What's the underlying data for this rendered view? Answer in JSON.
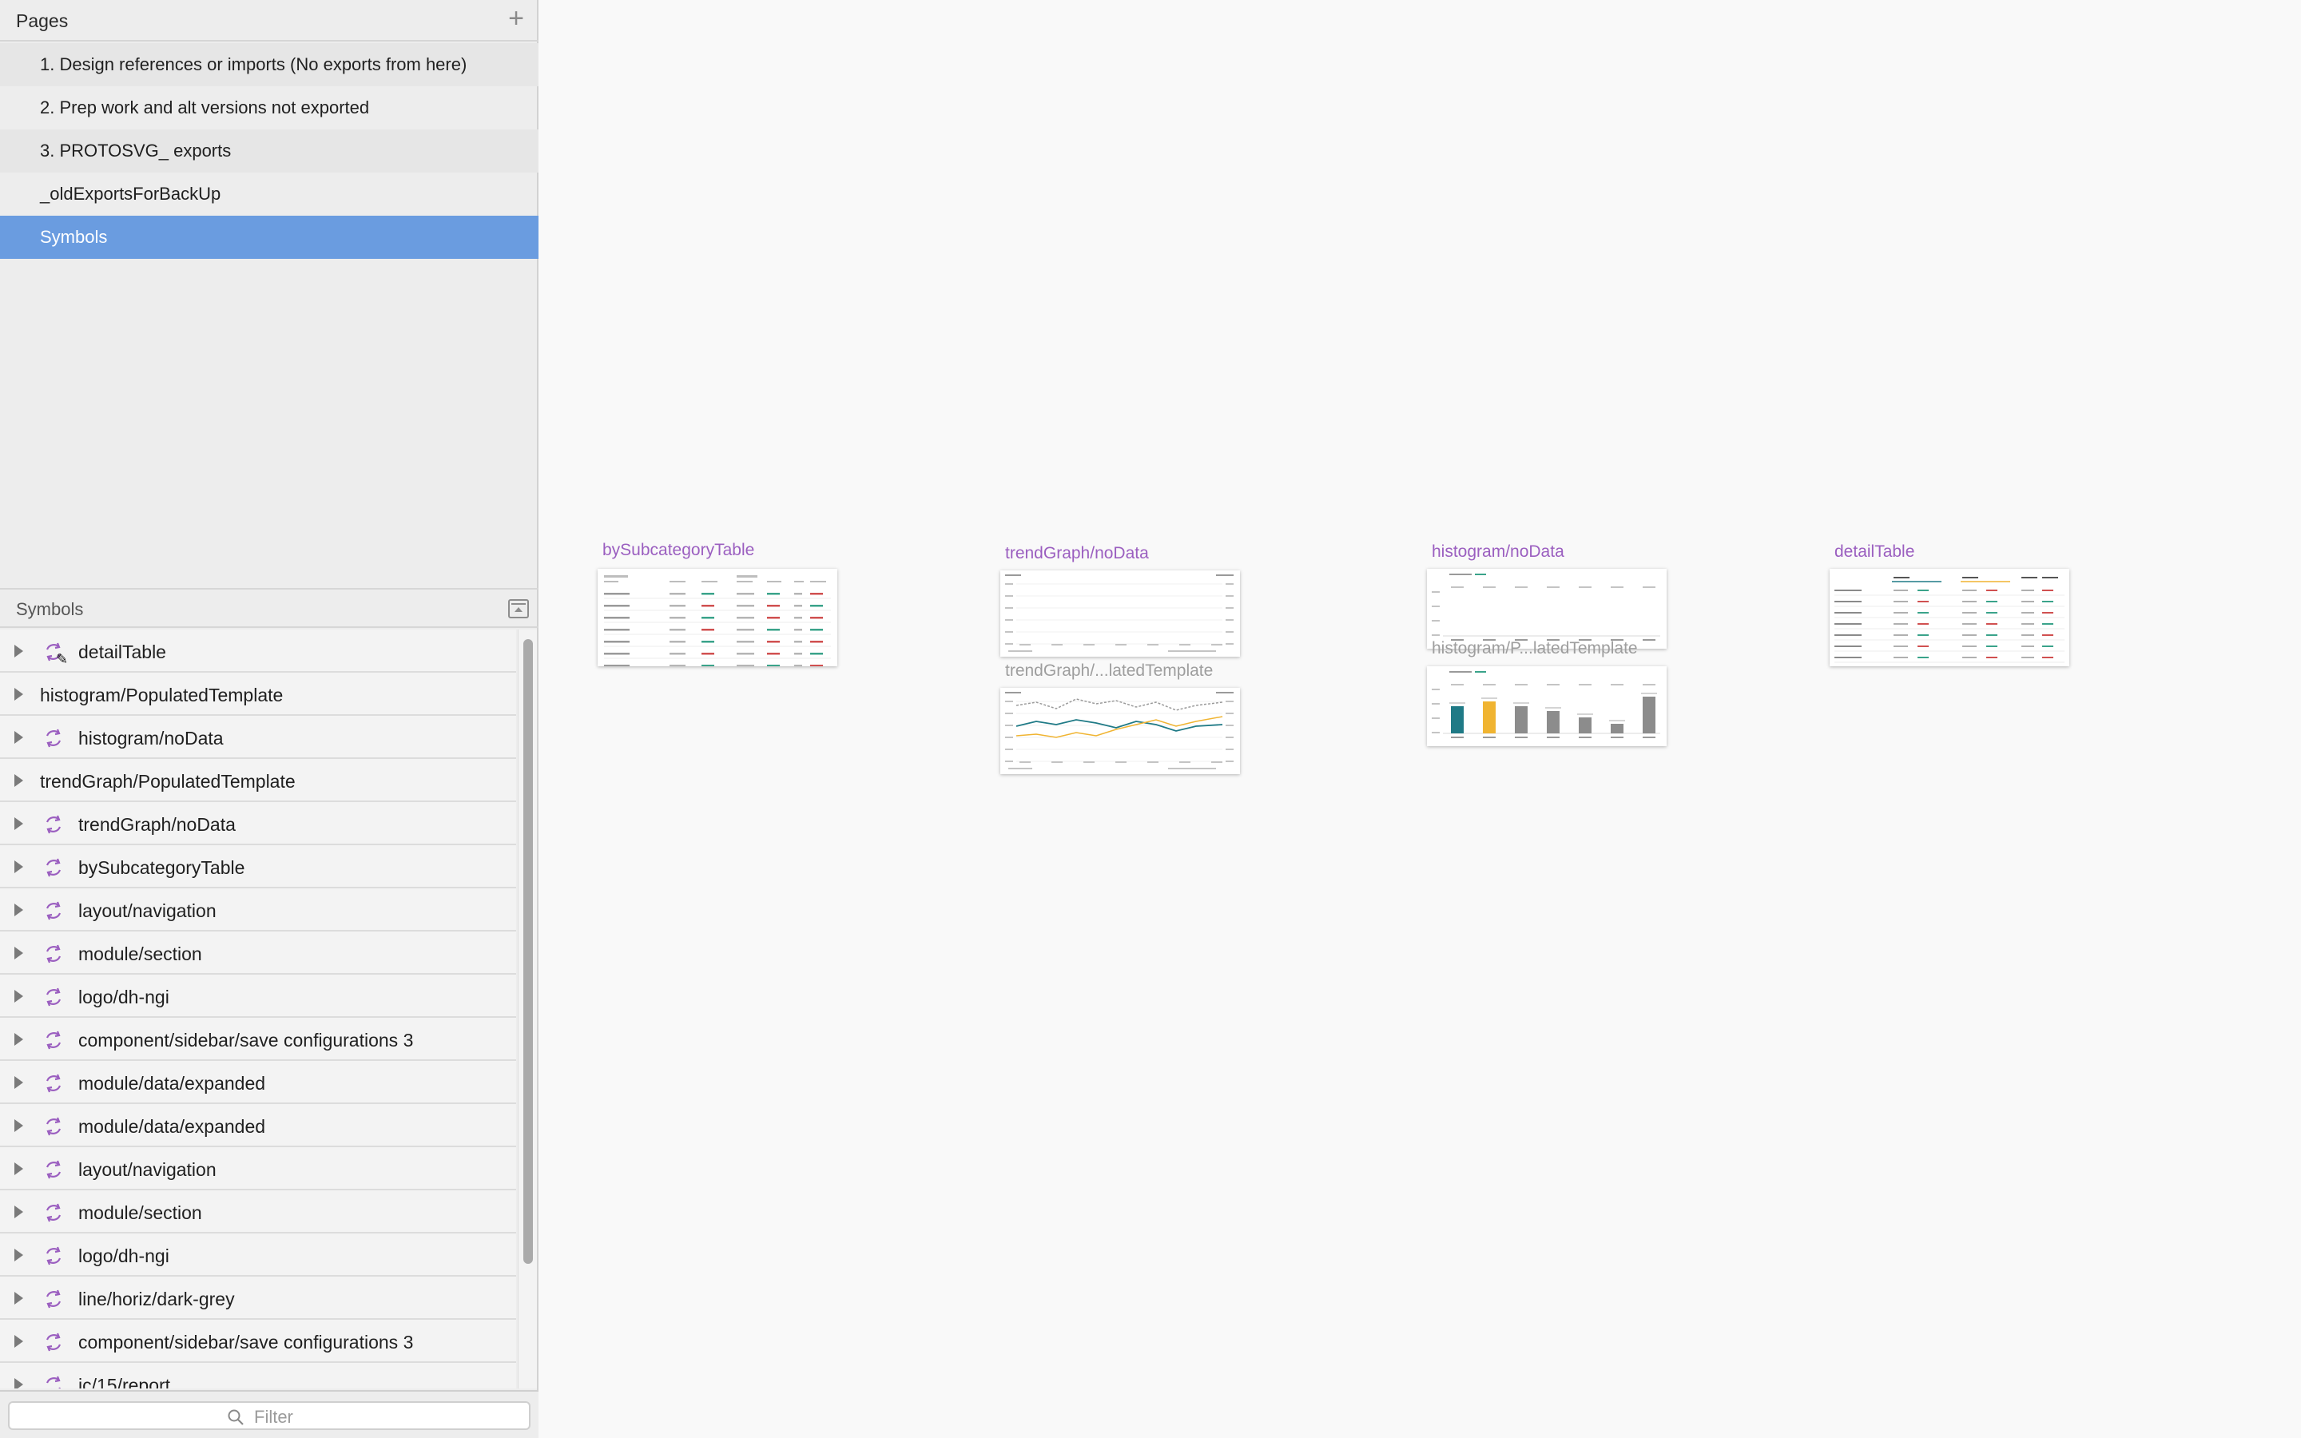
{
  "pages": {
    "title": "Pages",
    "add_icon": "plus-icon",
    "items": [
      {
        "label": "1. Design references or imports (No exports from here)"
      },
      {
        "label": "2. Prep work and alt versions not exported"
      },
      {
        "label": "3. PROTOSVG_ exports"
      },
      {
        "label": "_oldExportsForBackUp"
      },
      {
        "label": "Symbols"
      }
    ],
    "selected": "Symbols"
  },
  "layers": {
    "title": "Symbols",
    "items": [
      {
        "label": "detailTable",
        "symbol": true,
        "editing": true
      },
      {
        "label": "histogram/PopulatedTemplate",
        "symbol": false
      },
      {
        "label": "histogram/noData",
        "symbol": true
      },
      {
        "label": "trendGraph/PopulatedTemplate",
        "symbol": false
      },
      {
        "label": "trendGraph/noData",
        "symbol": true
      },
      {
        "label": "bySubcategoryTable",
        "symbol": true
      },
      {
        "label": "layout/navigation",
        "symbol": true
      },
      {
        "label": "module/section",
        "symbol": true
      },
      {
        "label": "logo/dh-ngi",
        "symbol": true
      },
      {
        "label": "component/sidebar/save configurations 3",
        "symbol": true
      },
      {
        "label": "module/data/expanded",
        "symbol": true
      },
      {
        "label": "module/data/expanded",
        "symbol": true
      },
      {
        "label": "layout/navigation",
        "symbol": true
      },
      {
        "label": "module/section",
        "symbol": true
      },
      {
        "label": "logo/dh-ngi",
        "symbol": true
      },
      {
        "label": "line/horiz/dark-grey",
        "symbol": true
      },
      {
        "label": "component/sidebar/save configurations 3",
        "symbol": true
      },
      {
        "label": "ic/15/report",
        "symbol": true
      }
    ]
  },
  "filter": {
    "placeholder": "Filter"
  },
  "canvas": {
    "artboards": [
      {
        "label": "bySubcategoryTable"
      },
      {
        "label": "trendGraph/noData"
      },
      {
        "label": "trendGraph/...latedTemplate"
      },
      {
        "label": "histogram/noData"
      },
      {
        "label": "histogram/P...latedTemplate"
      },
      {
        "label": "detailTable"
      }
    ]
  },
  "colors": {
    "accent": "#6a9ce0",
    "symbol_purple": "#9b5fc0",
    "chart_teal": "#1f7a86",
    "chart_yellow": "#f0b431",
    "chart_grey": "#8c8c8c"
  }
}
